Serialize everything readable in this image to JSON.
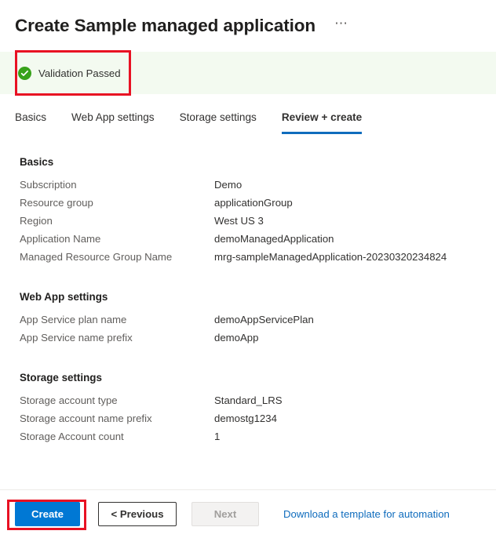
{
  "header": {
    "title": "Create Sample managed application",
    "more_options_label": "⋯"
  },
  "validation": {
    "status_text": "Validation Passed",
    "icon": "check-circle-icon",
    "banner_bg": "#f3faf0",
    "icon_color": "#37a21a"
  },
  "annotations": {
    "highlight_color": "#e81123"
  },
  "tabs": [
    {
      "label": "Basics",
      "active": false
    },
    {
      "label": "Web App settings",
      "active": false
    },
    {
      "label": "Storage settings",
      "active": false
    },
    {
      "label": "Review + create",
      "active": true
    }
  ],
  "sections": [
    {
      "title": "Basics",
      "rows": [
        {
          "label": "Subscription",
          "value": "Demo"
        },
        {
          "label": "Resource group",
          "value": "applicationGroup"
        },
        {
          "label": "Region",
          "value": "West US 3"
        },
        {
          "label": "Application Name",
          "value": "demoManagedApplication"
        },
        {
          "label": "Managed Resource Group Name",
          "value": "mrg-sampleManagedApplication-20230320234824"
        }
      ]
    },
    {
      "title": "Web App settings",
      "rows": [
        {
          "label": "App Service plan name",
          "value": "demoAppServicePlan"
        },
        {
          "label": "App Service name prefix",
          "value": "demoApp"
        }
      ]
    },
    {
      "title": "Storage settings",
      "rows": [
        {
          "label": "Storage account type",
          "value": "Standard_LRS"
        },
        {
          "label": "Storage account name prefix",
          "value": "demostg1234"
        },
        {
          "label": "Storage Account count",
          "value": "1"
        }
      ]
    }
  ],
  "footer": {
    "create_label": "Create",
    "previous_label": "< Previous",
    "next_label": "Next",
    "download_link_label": "Download a template for automation",
    "primary_color": "#0078d4",
    "link_color": "#0f6cbd"
  }
}
